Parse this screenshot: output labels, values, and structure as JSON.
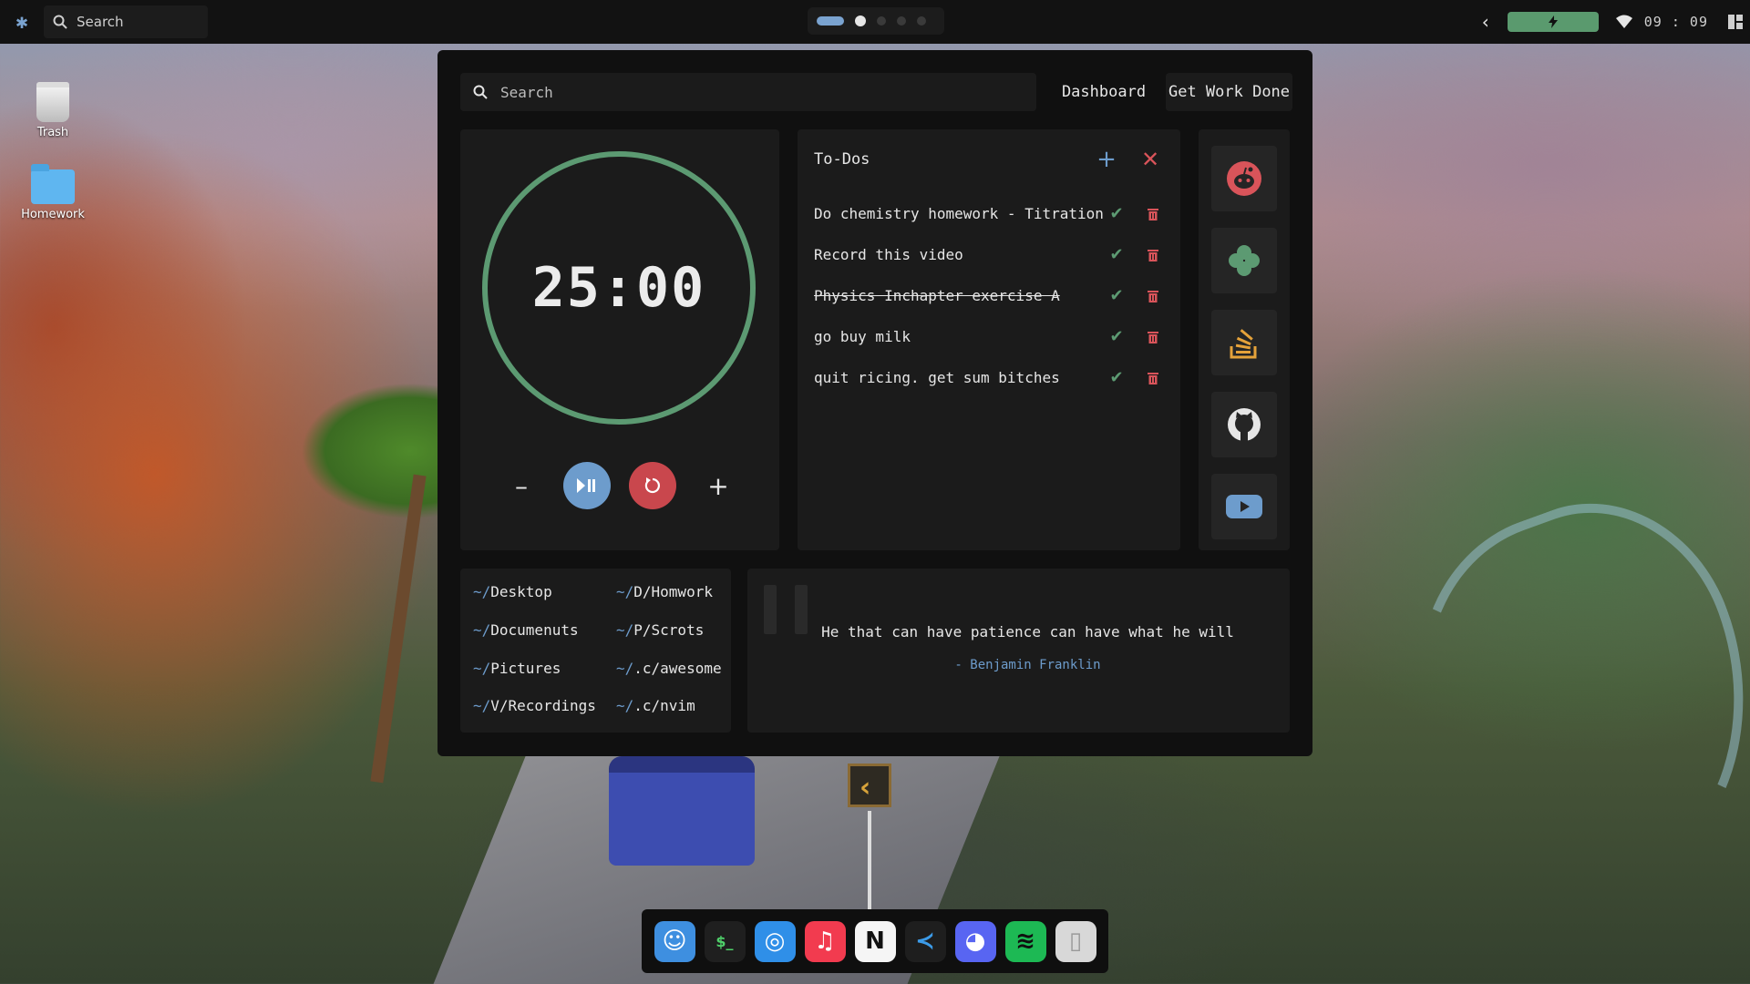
{
  "topbar": {
    "search_label": "Search",
    "workspaces": [
      "1",
      "2",
      "3",
      "4",
      "5"
    ],
    "active_workspace": 1,
    "battery_icon": "bolt-icon",
    "clock": "09 : 09",
    "accent": "#7aa3d0"
  },
  "desktop": {
    "trash_label": "Trash",
    "homework_label": "Homework"
  },
  "window": {
    "search_placeholder": "Search",
    "nav": {
      "dashboard": "Dashboard",
      "work": "Get Work Done"
    },
    "timer": {
      "time": "25:00",
      "ring_color": "#5c9a72",
      "minus": "–",
      "plus": "+"
    },
    "todos": {
      "title": "To-Dos",
      "items": [
        {
          "text": "Do chemistry homework - Titration",
          "done": false
        },
        {
          "text": "Record this video",
          "done": false
        },
        {
          "text": "Physics Inchapter exercise A",
          "done": true
        },
        {
          "text": "go buy milk",
          "done": false
        },
        {
          "text": "quit ricing. get sum bitches",
          "done": false
        }
      ]
    },
    "links": [
      "reddit-icon",
      "clover-icon",
      "stackoverflow-icon",
      "github-icon",
      "youtube-icon"
    ],
    "dirs": {
      "left": [
        {
          "prefix": "~/",
          "name": "Desktop"
        },
        {
          "prefix": "~/",
          "name": "Documenuts"
        },
        {
          "prefix": "~/",
          "name": "Pictures"
        },
        {
          "prefix": "~/",
          "name": "V/Recordings"
        }
      ],
      "right": [
        {
          "prefix": "~/",
          "name": "D/Homwork"
        },
        {
          "prefix": "~/",
          "name": "P/Scrots"
        },
        {
          "prefix": "~/",
          "name": ".c/awesome"
        },
        {
          "prefix": "~/",
          "name": ".c/nvim"
        }
      ]
    },
    "quote": {
      "text": "He that can have patience can have what he will",
      "author": "- Benjamin Franklin"
    }
  },
  "dock": {
    "apps": [
      {
        "name": "finder",
        "glyph": "☺",
        "bg": "#3e8fe0",
        "fg": "#ffffff"
      },
      {
        "name": "terminal",
        "glyph": "$_",
        "bg": "#1f1f1f",
        "fg": "#4fd06a"
      },
      {
        "name": "safari",
        "glyph": "◎",
        "bg": "#2f8fe8",
        "fg": "#ffffff"
      },
      {
        "name": "music",
        "glyph": "♫",
        "bg": "#f23b4f",
        "fg": "#ffffff"
      },
      {
        "name": "notion",
        "glyph": "N",
        "bg": "#f5f5f5",
        "fg": "#111111"
      },
      {
        "name": "vscode",
        "glyph": "≺",
        "bg": "#1e1e1e",
        "fg": "#3c9be8"
      },
      {
        "name": "discord",
        "glyph": "◕",
        "bg": "#5865f2",
        "fg": "#ffffff"
      },
      {
        "name": "spotify",
        "glyph": "≋",
        "bg": "#1db954",
        "fg": "#101010"
      },
      {
        "name": "trash",
        "glyph": "▯",
        "bg": "#d8d8d8",
        "fg": "#9a9a9a"
      }
    ]
  }
}
